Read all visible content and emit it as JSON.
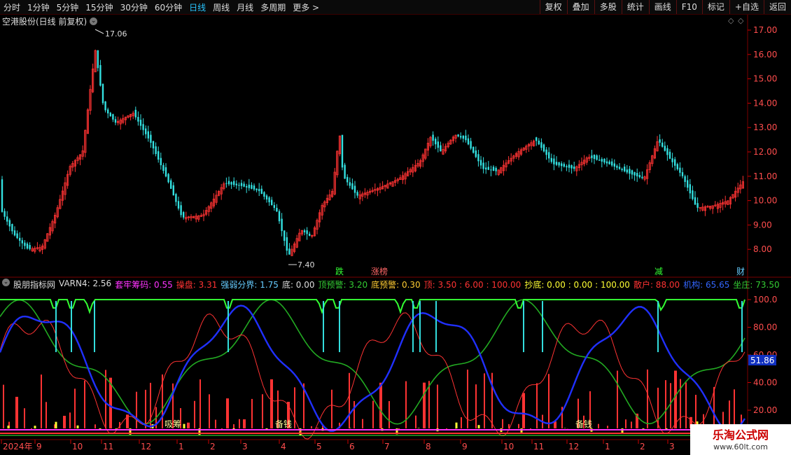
{
  "toolbar": {
    "periods": [
      "分时",
      "1分钟",
      "5分钟",
      "15分钟",
      "30分钟",
      "60分钟",
      "日线",
      "周线",
      "月线",
      "多周期",
      "更多 >"
    ],
    "active_period": "日线",
    "tools": [
      "复权",
      "叠加",
      "多股",
      "统计",
      "画线",
      "F10",
      "标记",
      "+自选",
      "返回"
    ]
  },
  "main_chart": {
    "title": "空港股份(日线 前复权)",
    "high_label": "17.06",
    "low_label": "7.40",
    "y_ticks": [
      "17.00",
      "16.00",
      "15.00",
      "14.00",
      "13.00",
      "12.00",
      "11.00",
      "10.00",
      "9.00",
      "8.00"
    ],
    "events": [
      "跌",
      "涨榜",
      "减",
      "财"
    ]
  },
  "indicator": {
    "name": "股朋指标网",
    "items": [
      {
        "label": "VARN4: 2.56",
        "color": "#dddddd"
      },
      {
        "label": "套牢筹码: 0.55",
        "color": "#ff33ff"
      },
      {
        "label": "操盘: 3.31",
        "color": "#ff3333"
      },
      {
        "label": "强弱分界: 1.75",
        "color": "#66ccff"
      },
      {
        "label": "底: 0.00",
        "color": "#dddddd"
      },
      {
        "label": "顶预警: 3.20",
        "color": "#33cc33"
      },
      {
        "label": "底预警: 0.30",
        "color": "#ffcc33"
      },
      {
        "label": "顶: 3.50 : 6.00 : 100.00",
        "color": "#ff3333"
      },
      {
        "label": "抄底: 0.00 : 0.00 : 100.00",
        "color": "#ffff33"
      },
      {
        "label": "散户: 88.00",
        "color": "#ff3333"
      },
      {
        "label": "机构: 65.65",
        "color": "#3366ff"
      },
      {
        "label": "坐庄: 73.50",
        "color": "#33cc33"
      }
    ],
    "y_ticks": [
      "100.0",
      "80.00",
      "60.00",
      "40.00",
      "20.00"
    ],
    "current_value": "51.86",
    "annotations": [
      "吸筹",
      "备钱",
      "备钱"
    ]
  },
  "x_axis": [
    "2024年",
    "9",
    "10",
    "11",
    "12",
    "1",
    "2",
    "3",
    "4",
    "5",
    "6",
    "7",
    "8",
    "9",
    "10",
    "11",
    "12",
    "1",
    "2",
    "3"
  ],
  "watermark": {
    "title": "乐淘公式网",
    "url": "www.60lt.com"
  },
  "colors": {
    "up": "#ff3333",
    "down": "#33e0e0",
    "grid": "#5a0000",
    "strong": "#00ff00",
    "inst": "#3333ff"
  }
}
